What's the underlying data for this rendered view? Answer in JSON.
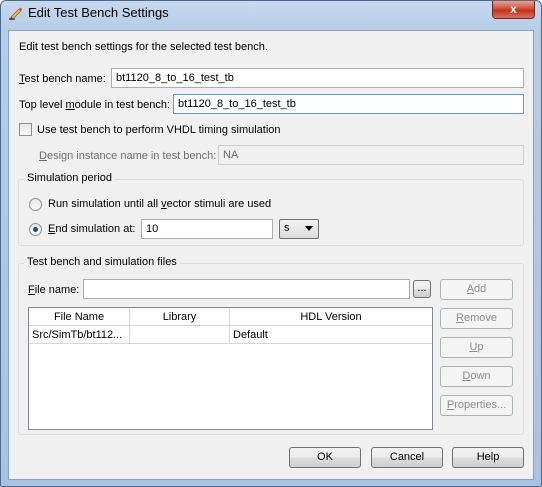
{
  "window": {
    "title": "Edit Test Bench Settings",
    "close_glyph": "x",
    "icon": "pencil-edit-icon"
  },
  "description": "Edit test bench settings for the selected test bench.",
  "test_bench_name": {
    "label_pre": "",
    "label_u": "T",
    "label_post": "est bench name:",
    "value": "bt1120_8_to_16_test_tb"
  },
  "top_level_module": {
    "label_pre": "Top level ",
    "label_u": "m",
    "label_post": "odule in test bench:",
    "value": "bt1120_8_to_16_test_tb"
  },
  "vhdl_timing": {
    "label": "Use test bench to perform VHDL timing simulation",
    "checked": false
  },
  "design_instance": {
    "label_pre": "",
    "label_u": "D",
    "label_post": "esign instance name in test bench:",
    "value": "NA"
  },
  "simulation_period": {
    "title": "Simulation period",
    "run_until": {
      "label_pre": "Run simulation until all ",
      "label_u": "v",
      "label_post": "ector stimuli are used",
      "selected": false
    },
    "end_at": {
      "label_pre": "",
      "label_u": "E",
      "label_post": "nd simulation at:",
      "selected": true,
      "value": "10",
      "unit": "s"
    }
  },
  "files_group": {
    "title": "Test bench and simulation files",
    "file_name": {
      "label_pre": "",
      "label_u": "F",
      "label_post": "ile name:",
      "value": "",
      "browse_label": "..."
    },
    "columns": [
      "File Name",
      "Library",
      "HDL Version"
    ],
    "rows": [
      {
        "file_name": "Src/SimTb/bt112...",
        "library": "",
        "hdl_version": "Default"
      }
    ],
    "buttons": {
      "add": {
        "pre": "",
        "u": "A",
        "post": "dd"
      },
      "remove": {
        "pre": "",
        "u": "R",
        "post": "emove"
      },
      "up": {
        "pre": "",
        "u": "U",
        "post": "p"
      },
      "down": {
        "pre": "",
        "u": "D",
        "post": "own"
      },
      "properties": {
        "pre": "",
        "u": "P",
        "post": "roperties..."
      }
    }
  },
  "footer": {
    "ok": "OK",
    "cancel": "Cancel",
    "help": "Help"
  },
  "colors": {
    "titlebar": "#b6cde8",
    "dialog_bg": "#f0f0f0",
    "close_button": "#c1321e",
    "focus_border": "#5a9be0"
  }
}
